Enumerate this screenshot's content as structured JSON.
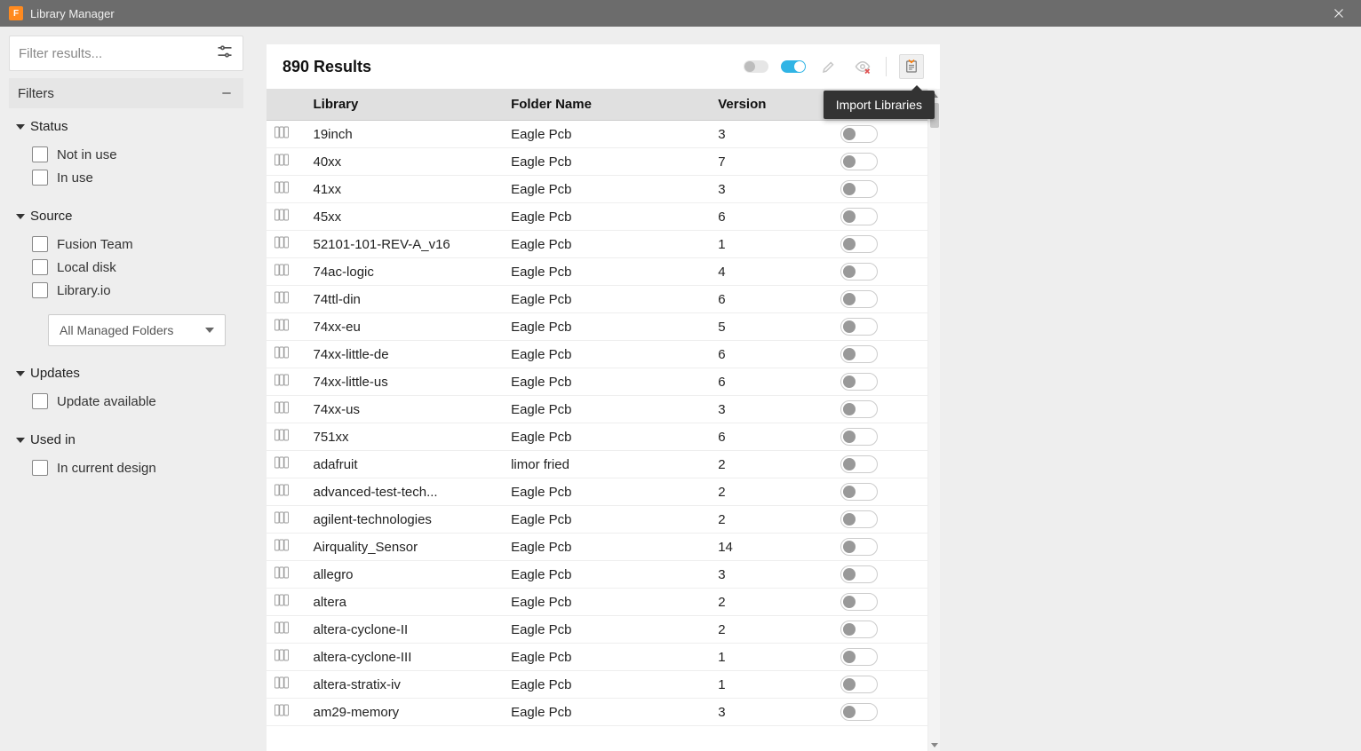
{
  "titlebar": {
    "title": "Library Manager"
  },
  "sidebar": {
    "filter_placeholder": "Filter results...",
    "filters_header": "Filters",
    "managed_folders_label": "All Managed Folders",
    "groups": [
      {
        "title": "Status",
        "items": [
          "Not in use",
          "In use"
        ]
      },
      {
        "title": "Source",
        "items": [
          "Fusion Team",
          "Local disk",
          "Library.io"
        ]
      },
      {
        "title": "Updates",
        "items": [
          "Update available"
        ]
      },
      {
        "title": "Used in",
        "items": [
          "In current design"
        ]
      }
    ]
  },
  "main": {
    "results_label": "890 Results",
    "tooltip": "Import Libraries",
    "columns": {
      "library": "Library",
      "folder": "Folder Name",
      "version": "Version"
    },
    "rows": [
      {
        "library": "19inch",
        "folder": "Eagle Pcb",
        "version": "3"
      },
      {
        "library": "40xx",
        "folder": "Eagle Pcb",
        "version": "7"
      },
      {
        "library": "41xx",
        "folder": "Eagle Pcb",
        "version": "3"
      },
      {
        "library": "45xx",
        "folder": "Eagle Pcb",
        "version": "6"
      },
      {
        "library": "52101-101-REV-A_v16",
        "folder": "Eagle Pcb",
        "version": "1"
      },
      {
        "library": "74ac-logic",
        "folder": "Eagle Pcb",
        "version": "4"
      },
      {
        "library": "74ttl-din",
        "folder": "Eagle Pcb",
        "version": "6"
      },
      {
        "library": "74xx-eu",
        "folder": "Eagle Pcb",
        "version": "5"
      },
      {
        "library": "74xx-little-de",
        "folder": "Eagle Pcb",
        "version": "6"
      },
      {
        "library": "74xx-little-us",
        "folder": "Eagle Pcb",
        "version": "6"
      },
      {
        "library": "74xx-us",
        "folder": "Eagle Pcb",
        "version": "3"
      },
      {
        "library": "751xx",
        "folder": "Eagle Pcb",
        "version": "6"
      },
      {
        "library": "adafruit",
        "folder": "limor fried",
        "version": "2"
      },
      {
        "library": "advanced-test-tech...",
        "folder": "Eagle Pcb",
        "version": "2"
      },
      {
        "library": "agilent-technologies",
        "folder": "Eagle Pcb",
        "version": "2"
      },
      {
        "library": "Airquality_Sensor",
        "folder": "Eagle Pcb",
        "version": "14"
      },
      {
        "library": "allegro",
        "folder": "Eagle Pcb",
        "version": "3"
      },
      {
        "library": "altera",
        "folder": "Eagle Pcb",
        "version": "2"
      },
      {
        "library": "altera-cyclone-II",
        "folder": "Eagle Pcb",
        "version": "2"
      },
      {
        "library": "altera-cyclone-III",
        "folder": "Eagle Pcb",
        "version": "1"
      },
      {
        "library": "altera-stratix-iv",
        "folder": "Eagle Pcb",
        "version": "1"
      },
      {
        "library": "am29-memory",
        "folder": "Eagle Pcb",
        "version": "3"
      }
    ]
  }
}
